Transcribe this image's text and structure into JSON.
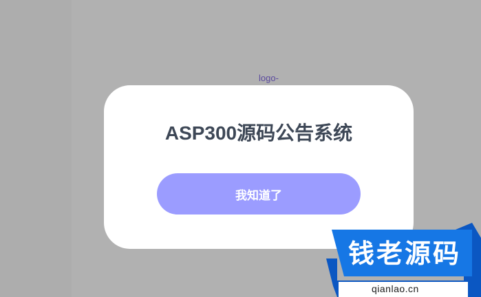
{
  "logo": {
    "alt_text": "logo-"
  },
  "modal": {
    "title": "ASP300源码公告系统",
    "confirm_label": "我知道了"
  },
  "watermark": {
    "brand": "钱老源码",
    "url": "qianlao.cn"
  },
  "colors": {
    "overlay": "#b1b1b1",
    "button": "#9b9cff",
    "title": "#3d4756",
    "watermark_blue": "#1677e5",
    "watermark_dark": "#0b57c2"
  }
}
